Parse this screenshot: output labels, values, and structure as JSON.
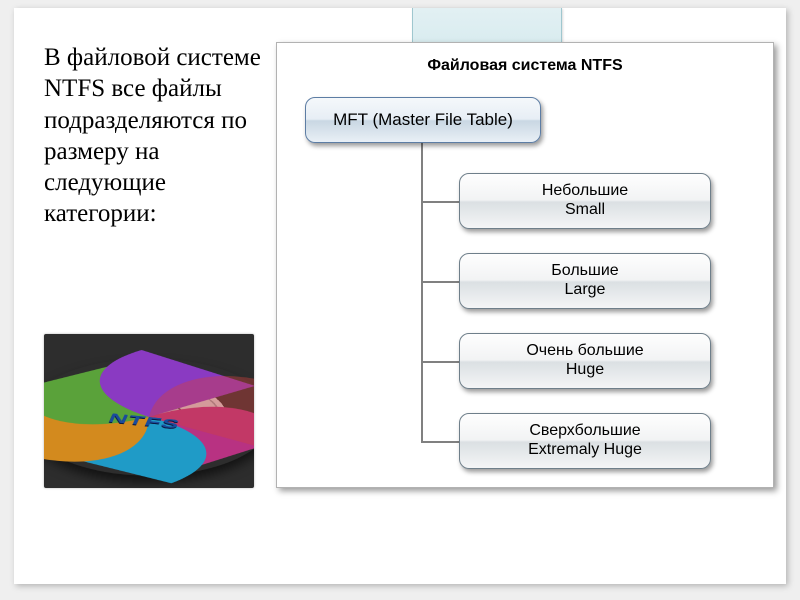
{
  "paragraph": "В файловой системе NTFS все файлы подразделяются по размеру на следующие категории:",
  "photo_label": "NTFS",
  "diagram": {
    "title": "Файловая система NTFS",
    "root": "MFT (Master File Table)",
    "children": [
      {
        "line1": "Небольшие",
        "line2": "Small"
      },
      {
        "line1": "Большие",
        "line2": "Large"
      },
      {
        "line1": "Очень большие",
        "line2": "Huge"
      },
      {
        "line1": "Сверхбольшие",
        "line2": "Extremaly Huge"
      }
    ]
  }
}
